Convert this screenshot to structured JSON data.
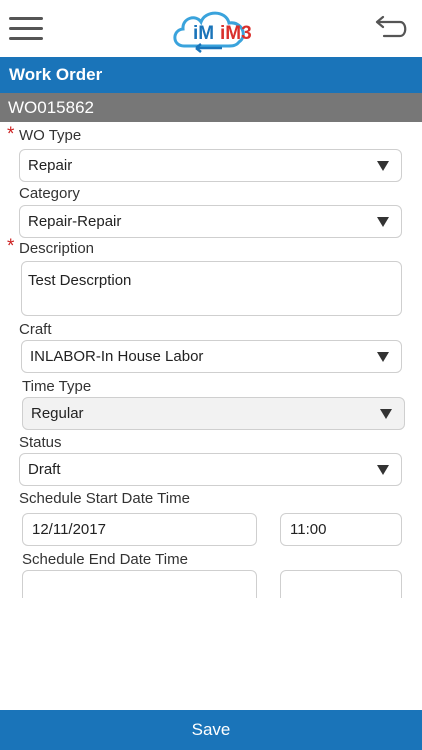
{
  "header": {
    "menu_icon": "hamburger-menu-icon",
    "logo_text": "iM3",
    "back_icon": "back-arrow-icon",
    "brand_color": "#1a74b9"
  },
  "page": {
    "title": "Work Order",
    "wo_number": "WO015862"
  },
  "form": {
    "wo_type": {
      "label": "WO Type",
      "value": "Repair",
      "required": true
    },
    "category": {
      "label": "Category",
      "value": "Repair-Repair"
    },
    "description": {
      "label": "Description",
      "value": "Test Descrption",
      "required": true
    },
    "craft": {
      "label": "Craft",
      "value": "INLABOR-In House Labor"
    },
    "time_type": {
      "label": "Time Type",
      "value": "Regular"
    },
    "status": {
      "label": "Status",
      "value": "Draft"
    },
    "schedule_start": {
      "label": "Schedule Start Date Time",
      "date": "12/11/2017",
      "time": "11:00"
    },
    "schedule_end": {
      "label": "Schedule End Date Time",
      "date": "",
      "time": ""
    }
  },
  "footer": {
    "save_label": "Save"
  },
  "colors": {
    "required": "#cc1f1f",
    "subheader": "#777777"
  }
}
